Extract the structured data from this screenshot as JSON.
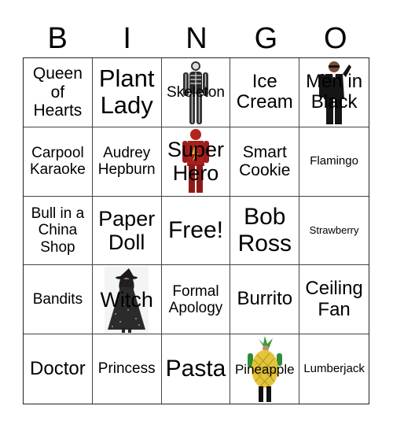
{
  "header": {
    "letters": [
      "B",
      "I",
      "N",
      "G",
      "O"
    ]
  },
  "cells": [
    {
      "label": "Queen of Hearts",
      "image": null
    },
    {
      "label": "Plant Lady",
      "image": null
    },
    {
      "label": "Skeleton",
      "image": "skeleton-costume"
    },
    {
      "label": "Ice Cream",
      "image": null
    },
    {
      "label": "Men in Black",
      "image": "men-in-black-costume"
    },
    {
      "label": "Carpool Karaoke",
      "image": null
    },
    {
      "label": "Audrey Hepburn",
      "image": null
    },
    {
      "label": "Super Hero",
      "image": "superhero-costume"
    },
    {
      "label": "Smart Cookie",
      "image": null
    },
    {
      "label": "Flamingo",
      "image": null
    },
    {
      "label": "Bull in a China Shop",
      "image": null
    },
    {
      "label": "Paper Doll",
      "image": null
    },
    {
      "label": "Free!",
      "image": null
    },
    {
      "label": "Bob Ross",
      "image": null
    },
    {
      "label": "Strawberry",
      "image": null
    },
    {
      "label": "Bandits",
      "image": null
    },
    {
      "label": "Witch",
      "image": "witch-costume"
    },
    {
      "label": "Formal Apology",
      "image": null
    },
    {
      "label": "Burrito",
      "image": null
    },
    {
      "label": "Ceiling Fan",
      "image": null
    },
    {
      "label": "Doctor",
      "image": null
    },
    {
      "label": "Princess",
      "image": null
    },
    {
      "label": "Pasta",
      "image": null
    },
    {
      "label": "Pineapple",
      "image": "pineapple-costume"
    },
    {
      "label": "Lumberjack",
      "image": null
    }
  ]
}
